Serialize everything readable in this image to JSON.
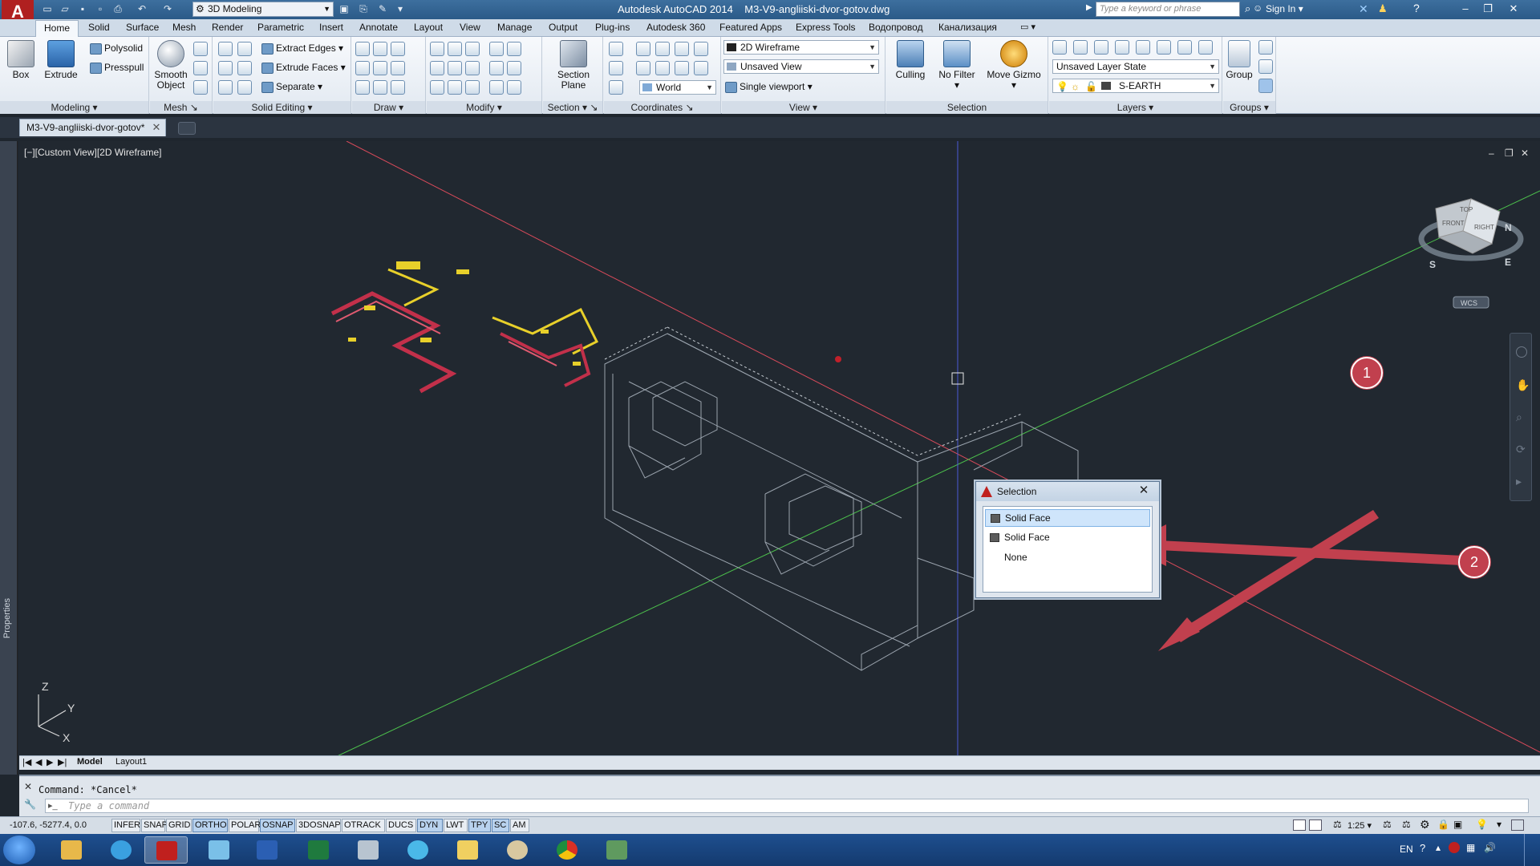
{
  "titlebar": {
    "workspace": "3D Modeling",
    "app_title": "Autodesk AutoCAD 2014",
    "file_title": "M3-V9-angliiski-dvor-gotov.dwg",
    "search_placeholder": "Type a keyword or phrase",
    "sign_in": "Sign In"
  },
  "ribbon_tabs": [
    "Home",
    "Solid",
    "Surface",
    "Mesh",
    "Render",
    "Parametric",
    "Insert",
    "Annotate",
    "Layout",
    "View",
    "Manage",
    "Output",
    "Plug-ins",
    "Autodesk 360",
    "Featured Apps",
    "Express Tools",
    "Водопровод",
    "Канализация"
  ],
  "ribbon": {
    "modeling": {
      "title": "Modeling",
      "box": "Box",
      "extrude": "Extrude",
      "polysolid": "Polysolid",
      "presspull": "Presspull"
    },
    "mesh": {
      "title": "Mesh",
      "smooth_line1": "Smooth",
      "smooth_line2": "Object"
    },
    "solid_editing": {
      "title": "Solid Editing",
      "extract_edges": "Extract Edges",
      "extrude_faces": "Extrude Faces",
      "separate": "Separate"
    },
    "draw": {
      "title": "Draw"
    },
    "modify": {
      "title": "Modify"
    },
    "section": {
      "title": "Section",
      "plane_line1": "Section",
      "plane_line2": "Plane"
    },
    "coordinates": {
      "title": "Coordinates",
      "world": "World"
    },
    "view": {
      "title": "View",
      "visual_style": "2D Wireframe",
      "named_view": "Unsaved View",
      "viewport": "Single viewport"
    },
    "selection": {
      "title": "Selection",
      "culling": "Culling",
      "no_filter": "No Filter",
      "move_gizmo": "Move Gizmo"
    },
    "layers": {
      "title": "Layers",
      "layer_state": "Unsaved Layer State",
      "current_layer": "S-EARTH"
    },
    "groups": {
      "title": "Groups",
      "group": "Group"
    }
  },
  "document_tab": "M3-V9-angliiski-dvor-gotov*",
  "viewport": {
    "label": "[−][Custom View][2D Wireframe]",
    "viewcube_labels": {
      "top": "TOP",
      "front": "FRONT",
      "right": "RIGHT",
      "n": "N",
      "s": "S",
      "e": "E"
    },
    "wcs": "WCS",
    "ucs_z": "Z",
    "ucs_y": "Y",
    "ucs_x": "X"
  },
  "side_label": "Properties",
  "layout_tabs": [
    "Model",
    "Layout1"
  ],
  "command": {
    "history": "Command: *Cancel*",
    "placeholder": "Type a command"
  },
  "status": {
    "coords": "-107.6, -5277.4, 0.0",
    "toggles": [
      {
        "label": "INFER",
        "on": false
      },
      {
        "label": "SNAP",
        "on": false
      },
      {
        "label": "GRID",
        "on": false
      },
      {
        "label": "ORTHO",
        "on": true
      },
      {
        "label": "POLAR",
        "on": false
      },
      {
        "label": "OSNAP",
        "on": true
      },
      {
        "label": "3DOSNAP",
        "on": false
      },
      {
        "label": "OTRACK",
        "on": false
      },
      {
        "label": "DUCS",
        "on": false
      },
      {
        "label": "DYN",
        "on": true
      },
      {
        "label": "LWT",
        "on": false
      },
      {
        "label": "TPY",
        "on": true
      },
      {
        "label": "SC",
        "on": true
      },
      {
        "label": "AM",
        "on": false
      }
    ],
    "scale": "1:25"
  },
  "selection_dialog": {
    "title": "Selection",
    "items": [
      "Solid Face",
      "Solid Face",
      "None"
    ]
  },
  "callouts": [
    "1",
    "2"
  ],
  "taskbar": {
    "lang": "EN"
  },
  "colors": {
    "accent": "#2b5a88",
    "viewport_bg": "#212830",
    "callout": "#c1404e",
    "x_axis": "#d84a5a",
    "y_axis": "#4cc04c",
    "z_axis": "#4a5ad8"
  }
}
